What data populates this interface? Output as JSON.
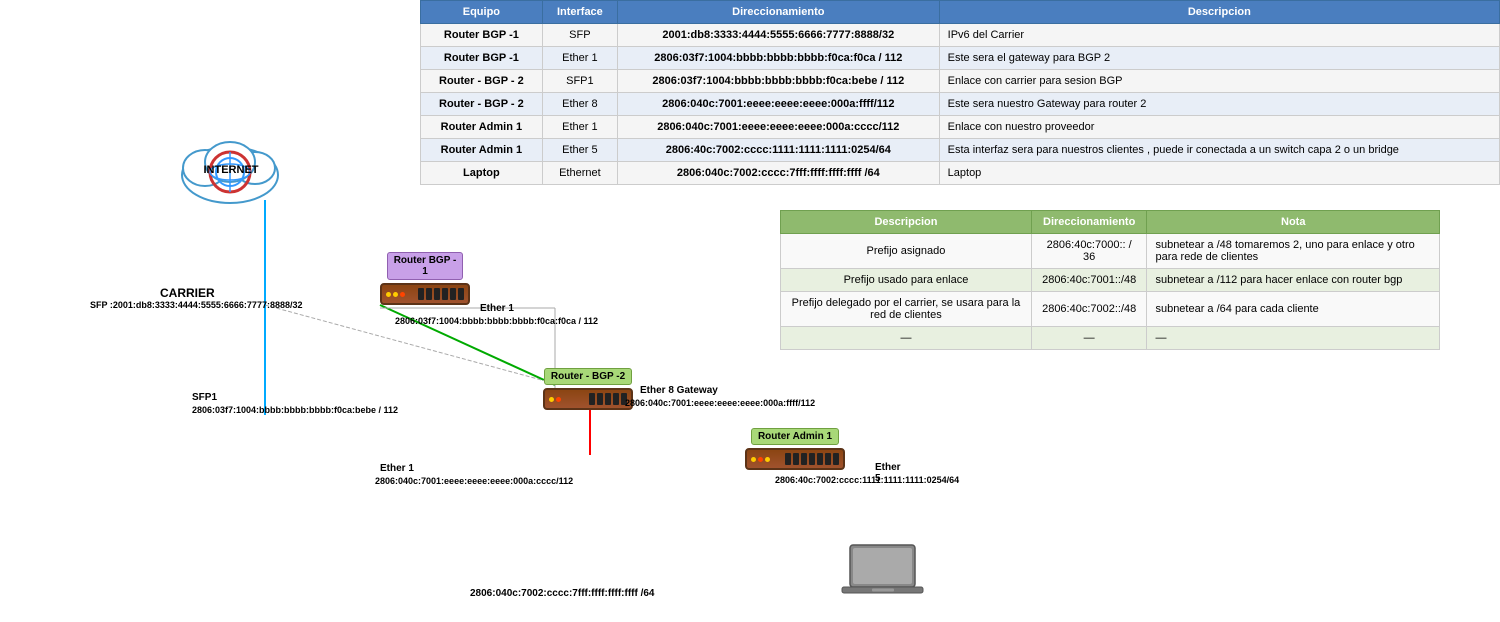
{
  "mainTable": {
    "headers": [
      "Equipo",
      "Interface",
      "Direccionamiento",
      "Descripcion"
    ],
    "rows": [
      [
        "Router BGP -1",
        "SFP",
        "2001:db8:3333:4444:5555:6666:7777:8888/32",
        "IPv6 del Carrier"
      ],
      [
        "Router BGP -1",
        "Ether 1",
        "2806:03f7:1004:bbbb:bbbb:bbbb:f0ca:f0ca / 112",
        "Este sera el gateway para BGP 2"
      ],
      [
        "Router - BGP - 2",
        "SFP1",
        "2806:03f7:1004:bbbb:bbbb:bbbb:f0ca:bebe / 112",
        "Enlace con carrier para sesion BGP"
      ],
      [
        "Router - BGP - 2",
        "Ether 8",
        "2806:040c:7001:eeee:eeee:eeee:000a:ffff/112",
        "Este sera nuestro Gateway para router 2"
      ],
      [
        "Router Admin 1",
        "Ether 1",
        "2806:040c:7001:eeee:eeee:eeee:000a:cccc/112",
        "Enlace con nuestro proveedor"
      ],
      [
        "Router Admin 1",
        "Ether 5",
        "2806:40c:7002:cccc:1111:1111:1111:0254/64",
        "Esta interfaz sera para nuestros clientes , puede ir conectada a un switch capa 2 o un bridge"
      ],
      [
        "Laptop",
        "Ethernet",
        "2806:040c:7002:cccc:7fff:ffff:ffff:ffff /64",
        "Laptop"
      ]
    ]
  },
  "table2": {
    "headers": [
      "Descripcion",
      "Direccionamiento",
      "Nota"
    ],
    "rows": [
      [
        "Prefijo asignado",
        "2806:40c:7000:: / 36",
        "subnetear a /48  tomaremos 2, uno para enlace y otro para rede de clientes"
      ],
      [
        "Prefijo usado para enlace",
        "2806:40c:7001::/48",
        "subnetear a /112 para hacer enlace con router bgp"
      ],
      [
        "Prefijo delegado por el carrier, se usara para la red de clientes",
        "2806:40c:7002::/48",
        "subnetear a /64 para cada cliente"
      ],
      [
        "—",
        "—",
        "—"
      ]
    ]
  },
  "diagram": {
    "internet_label": "INTERNET",
    "carrier_label": "CARRIER",
    "carrier_addr": "SFP :2001:db8:3333:4444:5555:6666:7777:8888/32",
    "router_bgp1_label": "Router BGP -\n1",
    "router_bgp2_label": "Router - BGP -2",
    "router_admin1_label": "Router Admin 1",
    "laptop_label": "Laptop",
    "ether1_bgp1_label": "Ether 1",
    "ether1_bgp1_addr": "2806:03f7:1004:bbbb:bbbb:bbbb:f0ca:f0ca / 112",
    "sfp1_bgp2_label": "SFP1",
    "sfp1_bgp2_addr": "2806:03f7:1004:bbbb:bbbb:bbbb:f0ca:bebe / 112",
    "ether8_label": "Ether 8 Gateway",
    "ether8_addr": "2806:040c:7001:eeee:eeee:eeee:000a:ffff/112",
    "ether1_admin_label": "Ether 1",
    "ether1_admin_addr": "2806:040c:7001:eeee:eeee:eeee:000a:cccc/112",
    "ether5_label": "Ether 5",
    "ether5_addr": "2806:40c:7002:cccc:1111:1111:1111:0254/64",
    "laptop_addr": "2806:040c:7002:cccc:7fff:ffff:ffff:ffff /64"
  }
}
